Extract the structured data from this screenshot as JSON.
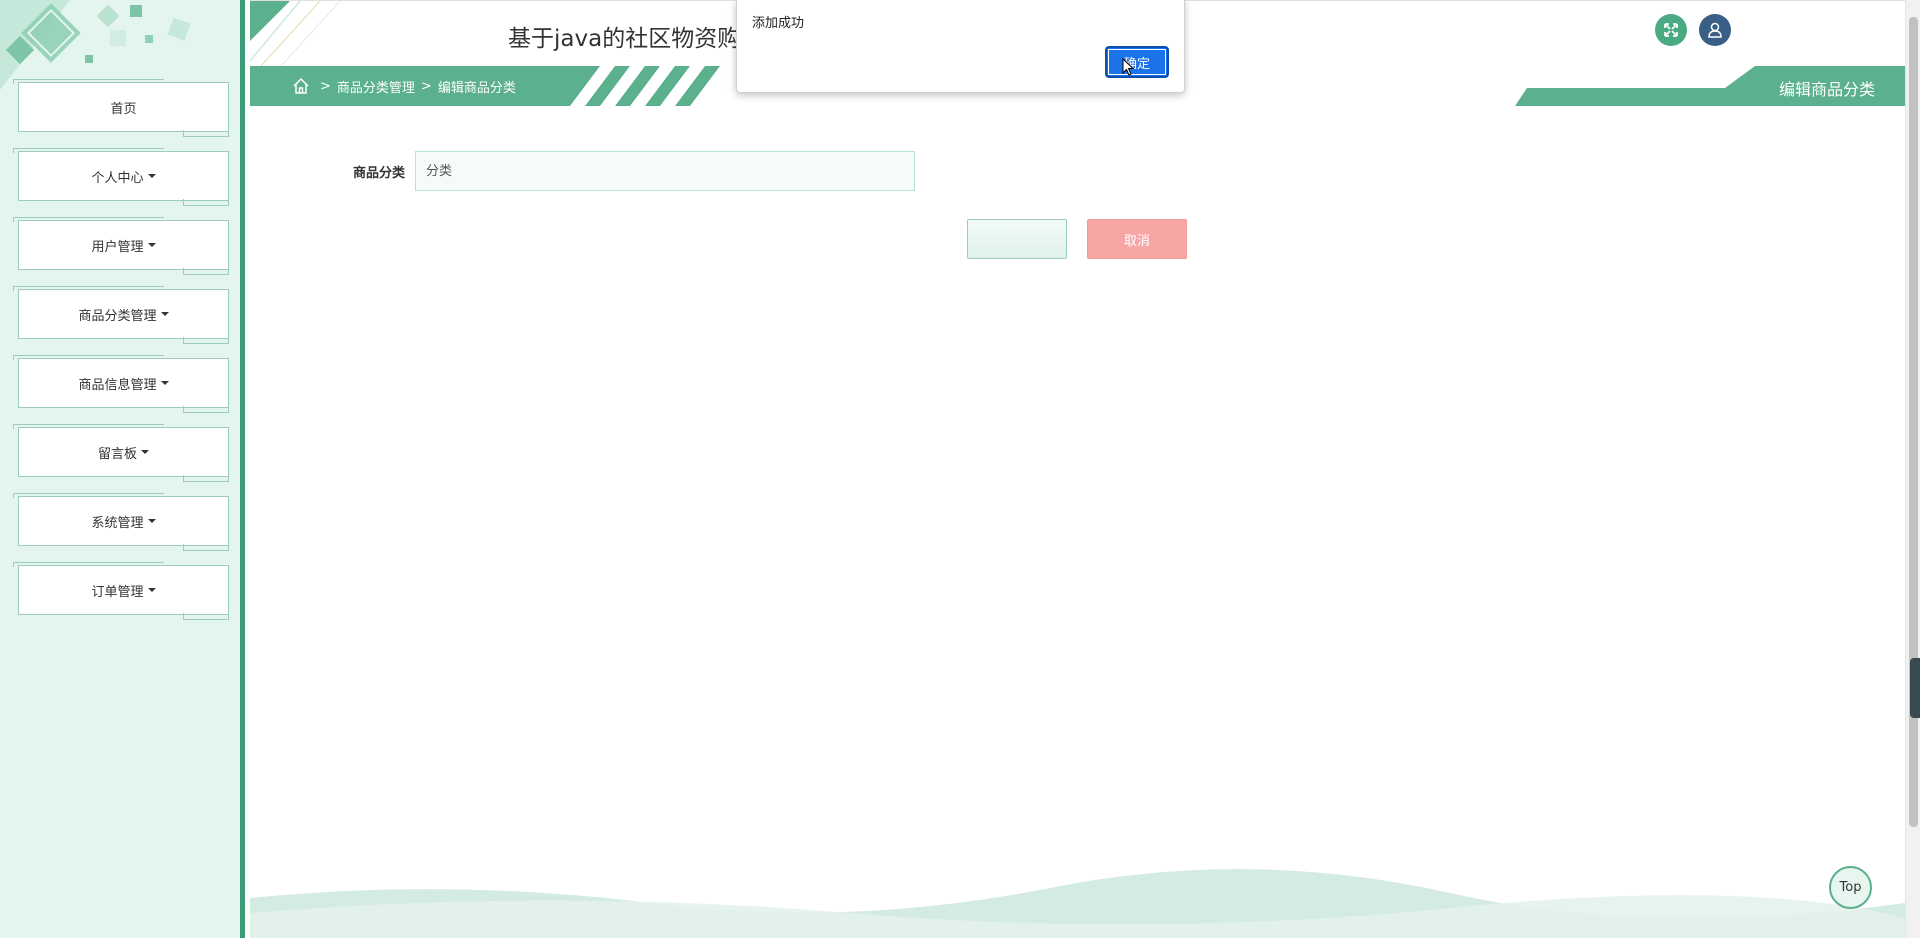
{
  "header": {
    "site_title": "基于java的社区物资购",
    "breadcrumb": [
      "商品分类管理",
      "编辑商品分类"
    ],
    "page_title": "编辑商品分类"
  },
  "sidebar": {
    "items": [
      {
        "label": "首页",
        "has_caret": false
      },
      {
        "label": "个人中心",
        "has_caret": true
      },
      {
        "label": "用户管理",
        "has_caret": true
      },
      {
        "label": "商品分类管理",
        "has_caret": true
      },
      {
        "label": "商品信息管理",
        "has_caret": true
      },
      {
        "label": "留言板",
        "has_caret": true
      },
      {
        "label": "系统管理",
        "has_caret": true
      },
      {
        "label": "订单管理",
        "has_caret": true
      }
    ]
  },
  "form": {
    "category_label": "商品分类",
    "category_placeholder": "分类",
    "submit_label": "",
    "cancel_label": "取消"
  },
  "alert": {
    "message": "添加成功",
    "ok_label": "确定"
  },
  "top_button": "Top",
  "colors": {
    "primary": "#5bb08e",
    "sidebar_bg": "#e3f5ee",
    "cancel": "#f8a5a5",
    "dialog_button": "#1a73e8"
  }
}
